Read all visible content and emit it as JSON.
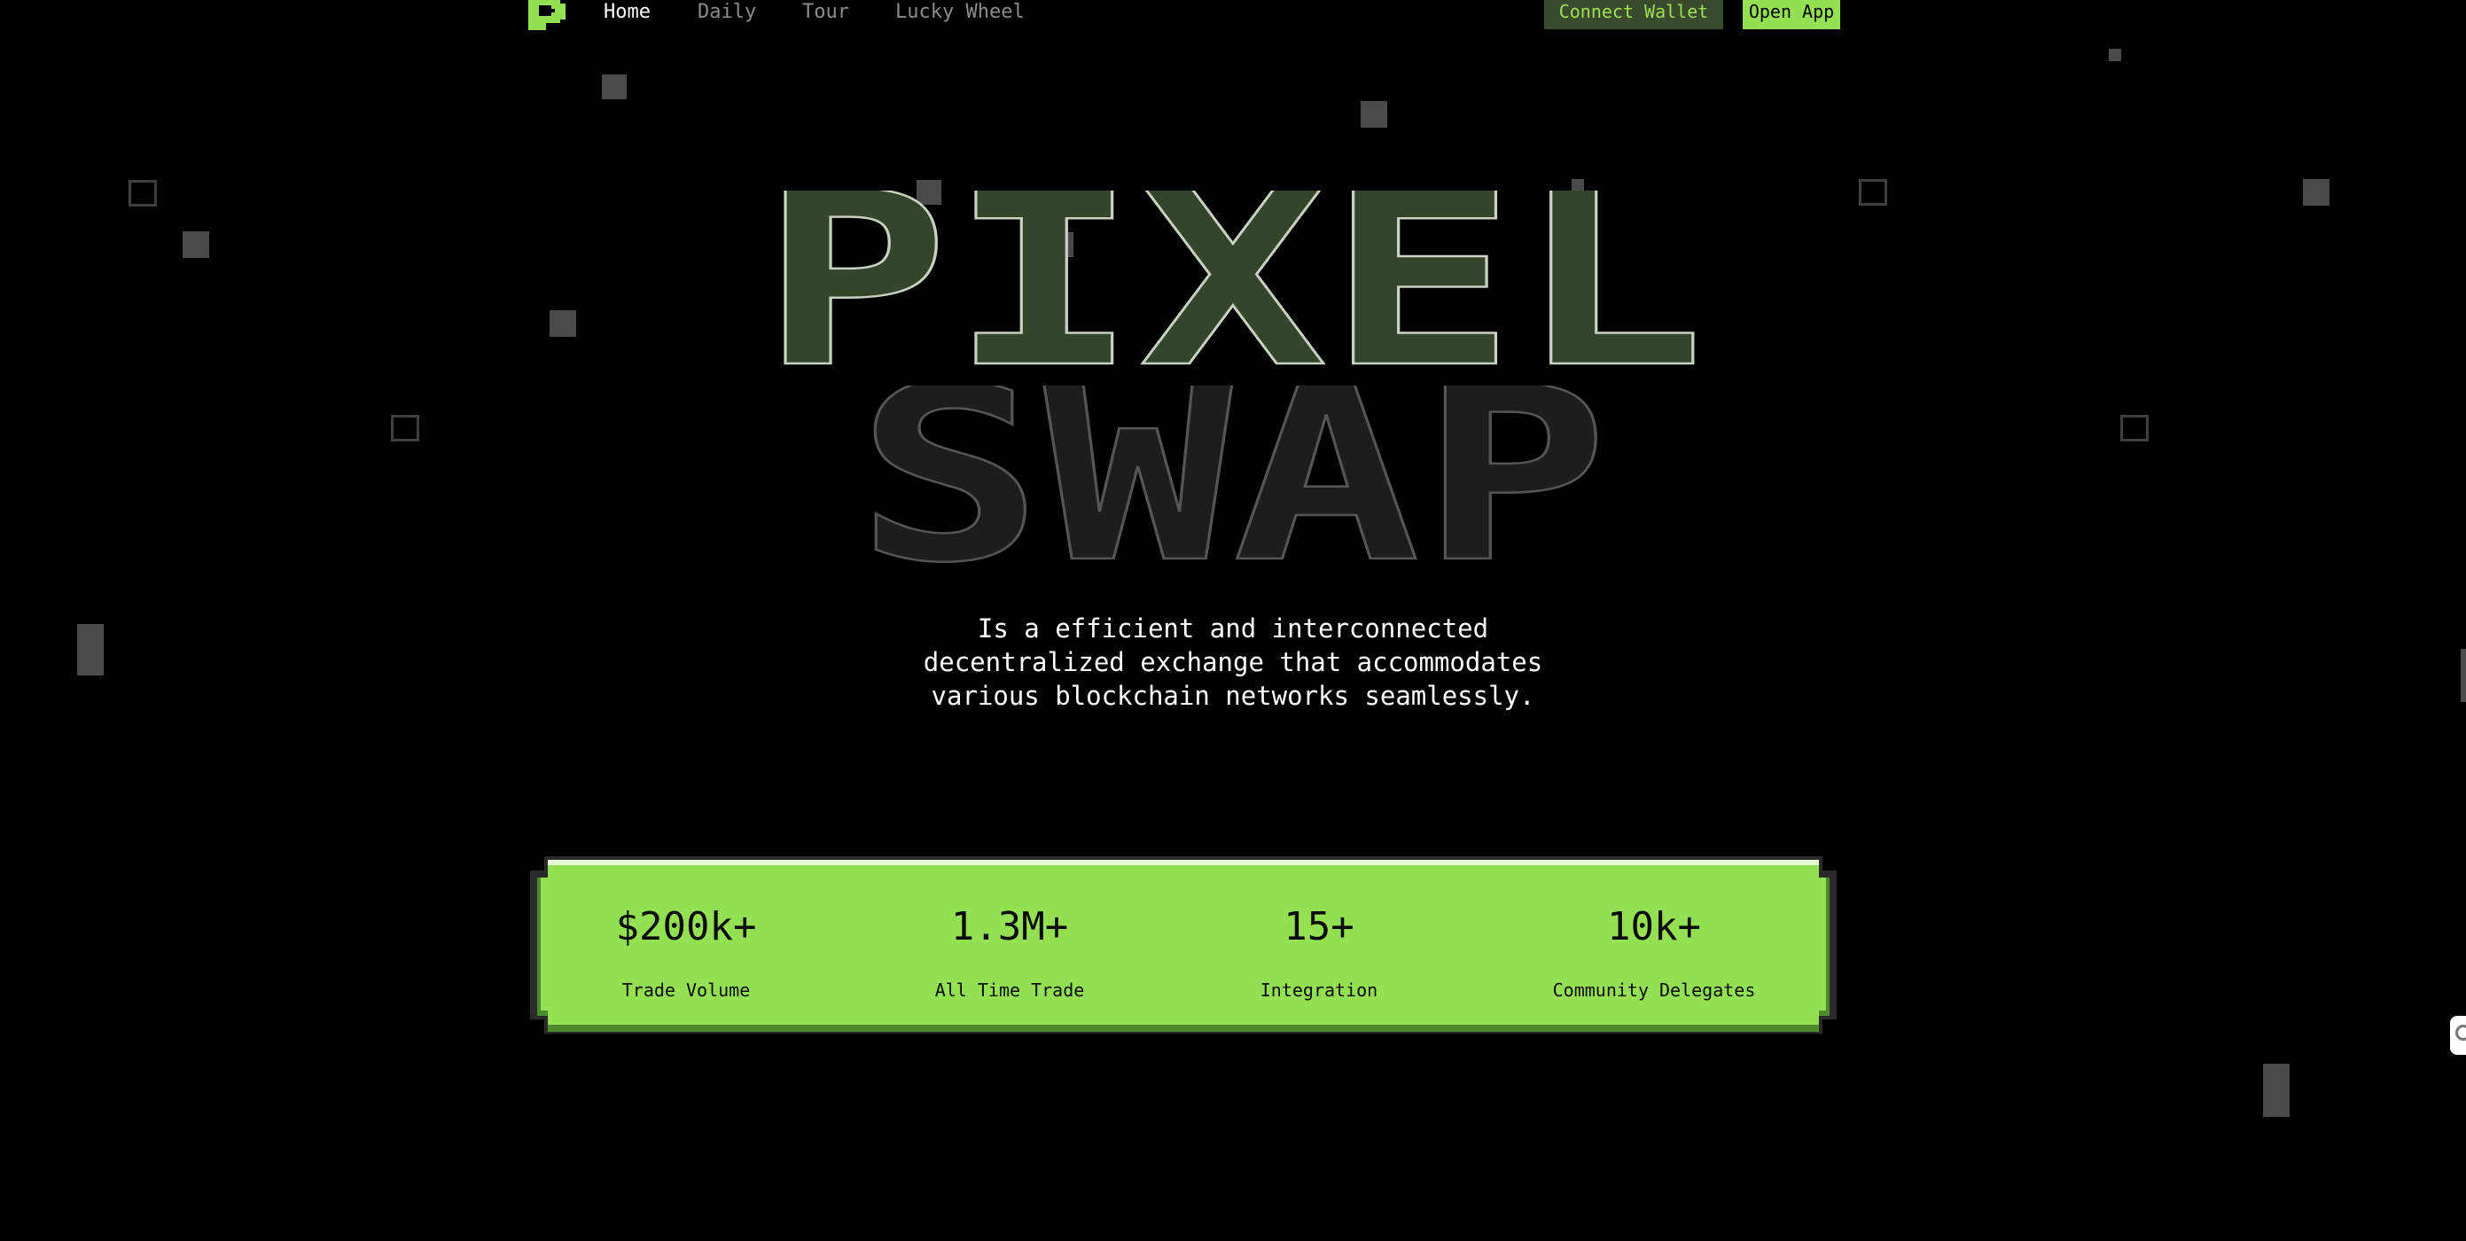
{
  "nav": {
    "logo": "logo-icon",
    "items": [
      {
        "label": "Home",
        "active": true
      },
      {
        "label": "Daily",
        "active": false
      },
      {
        "label": "Tour",
        "active": false
      },
      {
        "label": "Lucky Wheel",
        "active": false
      }
    ],
    "connect_wallet": "Connect Wallet",
    "open_app": "Open App"
  },
  "hero": {
    "line1": "PIXEL",
    "line2": "SWAP",
    "tagline": [
      "Is a efficient and interconnected",
      "decentralized exchange that accommodates",
      "various blockchain networks seamlessly."
    ]
  },
  "stats": [
    {
      "value": "$200k+",
      "label": "Trade Volume"
    },
    {
      "value": "1.3M+",
      "label": "All Time Trade"
    },
    {
      "value": "15+",
      "label": "Integration"
    },
    {
      "value": "10k+",
      "label": "Community Delegates"
    }
  ],
  "colors": {
    "accent": "#93e052",
    "accent_dark": "#3a4a2c",
    "background": "#000000"
  }
}
